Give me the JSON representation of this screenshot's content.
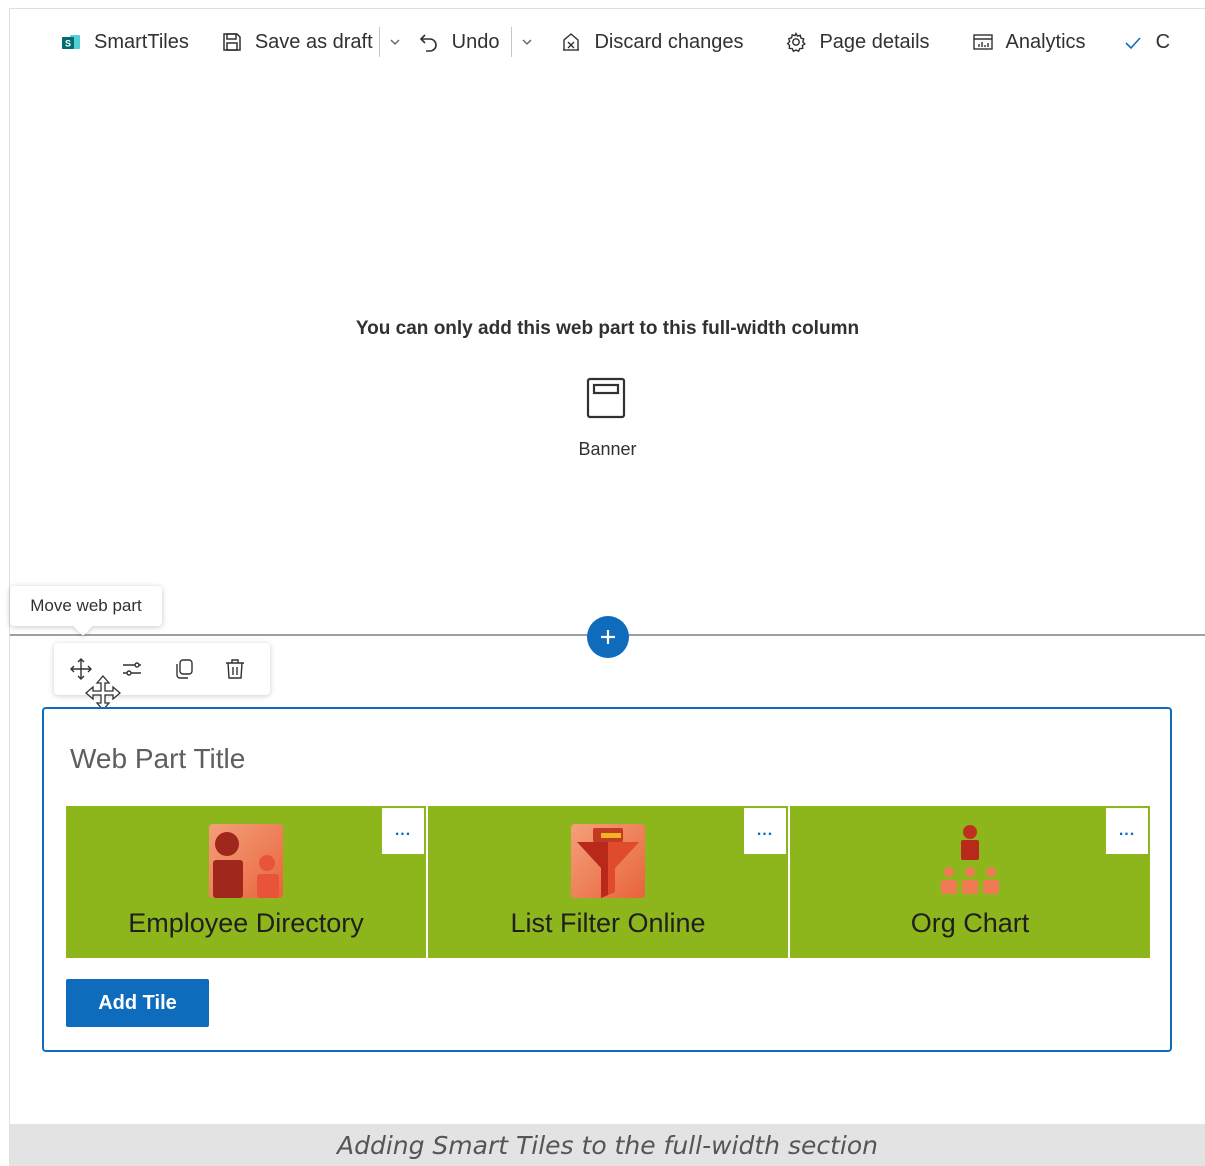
{
  "commandbar": {
    "items": [
      {
        "label": "SmartTiles",
        "icon": "sharepoint-app-icon"
      },
      {
        "label": "Save as draft",
        "icon": "save-icon"
      },
      {
        "label": "Undo",
        "icon": "undo-icon"
      },
      {
        "label": "Discard changes",
        "icon": "discard-icon"
      },
      {
        "label": "Page details",
        "icon": "gear-icon"
      },
      {
        "label": "Analytics",
        "icon": "analytics-icon"
      },
      {
        "label": "C",
        "icon": "checkmark-icon"
      }
    ]
  },
  "zone": {
    "message": "You can only add this web part to this full-width column",
    "banner_label": "Banner"
  },
  "tooltip": {
    "text": "Move web part"
  },
  "toolbar": {
    "tools": [
      "move-icon",
      "settings-sliders-icon",
      "duplicate-icon",
      "delete-icon"
    ]
  },
  "webpart": {
    "title": "Web Part Title",
    "tiles": [
      {
        "label": "Employee Directory",
        "more": "..."
      },
      {
        "label": "List Filter Online",
        "more": "..."
      },
      {
        "label": "Org Chart",
        "more": "..."
      }
    ],
    "add_tile_label": "Add Tile",
    "tile_color": "#8cb61b",
    "accent_color": "#0f6cbd"
  },
  "caption": "Adding Smart Tiles to the full-width section"
}
